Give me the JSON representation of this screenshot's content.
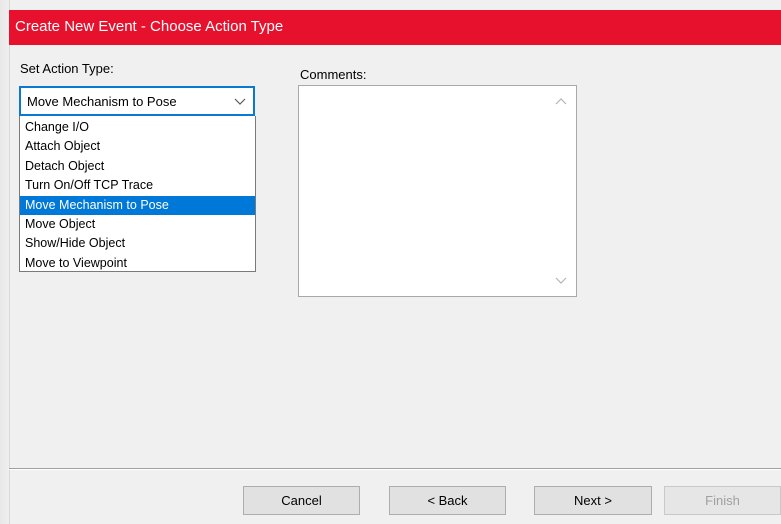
{
  "dialog": {
    "title": "Create New Event - Choose Action Type",
    "accent_color": "#e8112d"
  },
  "action_type": {
    "label": "Set Action Type:",
    "selected_value": "Move Mechanism to Pose",
    "chevron_icon": "chevron-down-icon",
    "options": [
      "Change I/O",
      "Attach Object",
      "Detach Object",
      "Turn On/Off TCP Trace",
      "Move Mechanism to Pose",
      "Move Object",
      "Show/Hide Object",
      "Move to Viewpoint"
    ],
    "highlighted_option": "Move Mechanism to Pose",
    "highlight_color": "#0078d7"
  },
  "comments": {
    "label": "Comments:",
    "value": ""
  },
  "buttons": {
    "cancel": "Cancel",
    "back": "< Back",
    "next": "Next >",
    "finish": "Finish",
    "finish_enabled": false
  }
}
